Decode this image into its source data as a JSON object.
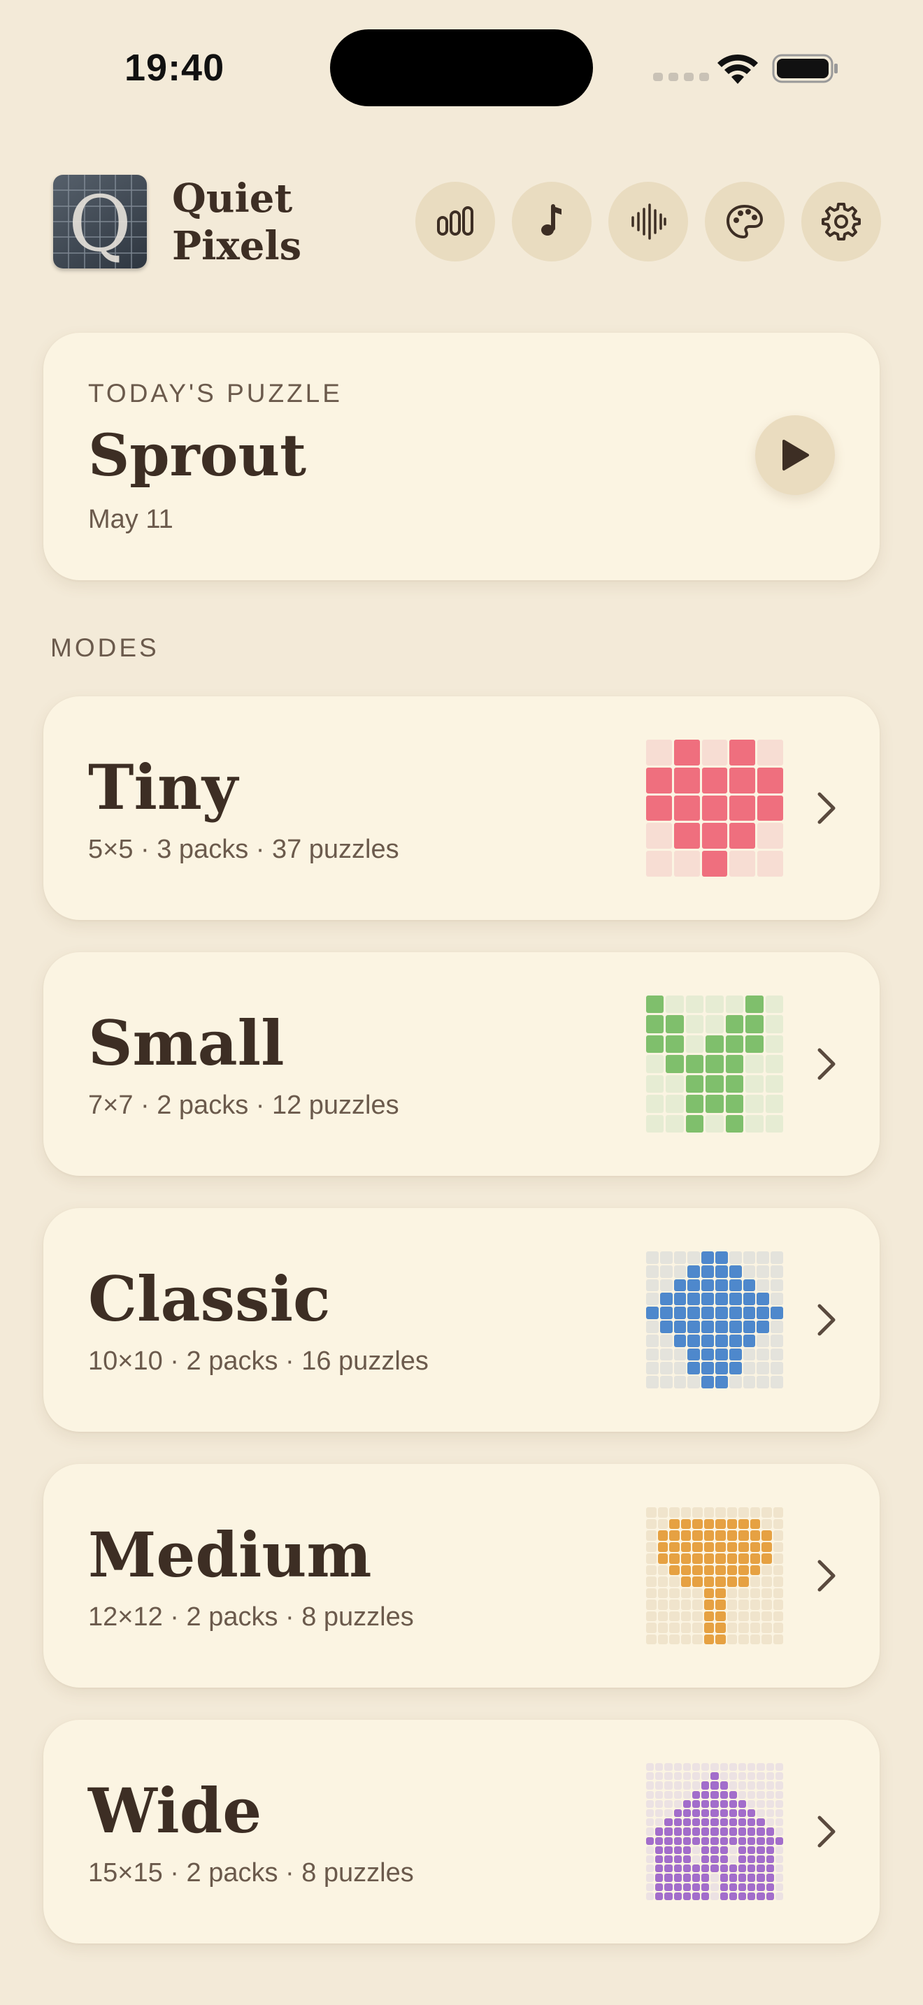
{
  "status_bar": {
    "time": "19:40"
  },
  "header": {
    "app_name_line1": "Quiet",
    "app_name_line2": "Pixels",
    "buttons": [
      "stats-icon",
      "music-icon",
      "sound-icon",
      "palette-icon",
      "gear-icon"
    ]
  },
  "today": {
    "label": "TODAY'S PUZZLE",
    "title": "Sprout",
    "date": "May 11"
  },
  "modes_label": "MODES",
  "modes": [
    {
      "title": "Tiny",
      "meta": "5×5 · 3 packs · 37 puzzles",
      "color": "#ef6f7e",
      "empty_color": "#f7ddd3",
      "size": 5,
      "pattern": [
        "01010",
        "11111",
        "11111",
        "01110",
        "00100"
      ]
    },
    {
      "title": "Small",
      "meta": "7×7 · 2 packs · 12 puzzles",
      "color": "#7fbf6c",
      "empty_color": "#e6ecd3",
      "size": 7,
      "pattern": [
        "1000010",
        "1100110",
        "1101110",
        "0111100",
        "0011100",
        "0011100",
        "0010100"
      ]
    },
    {
      "title": "Classic",
      "meta": "10×10 · 2 packs · 16 puzzles",
      "color": "#4e88cc",
      "empty_color": "#e4e3dc",
      "size": 10,
      "pattern": [
        "0000110000",
        "0001111000",
        "0011111100",
        "0111111110",
        "1111111111",
        "0111111110",
        "0011111100",
        "0001111000",
        "0001111000",
        "0000110000"
      ]
    },
    {
      "title": "Medium",
      "meta": "12×12 · 2 packs · 8 puzzles",
      "color": "#e6a142",
      "empty_color": "#f0e4cc",
      "size": 12,
      "pattern": [
        "000000000000",
        "001111111100",
        "011111111110",
        "011111111110",
        "011111111110",
        "001111111100",
        "000111111000",
        "000001100000",
        "000001100000",
        "000001100000",
        "000001100000",
        "000001100000"
      ]
    },
    {
      "title": "Wide",
      "meta": "15×15 · 2 packs · 8 puzzles",
      "color": "#a26dcb",
      "empty_color": "#ece2e3",
      "size": 15,
      "pattern": [
        "000000000000000",
        "000000010000000",
        "000000111000000",
        "000001111100000",
        "000011111110000",
        "000111111111000",
        "001111111111100",
        "011111111111110",
        "111111111111111",
        "011110111011110",
        "011110111011110",
        "011111111111110",
        "011111101111110",
        "011111101111110",
        "011111101111110"
      ]
    }
  ]
}
